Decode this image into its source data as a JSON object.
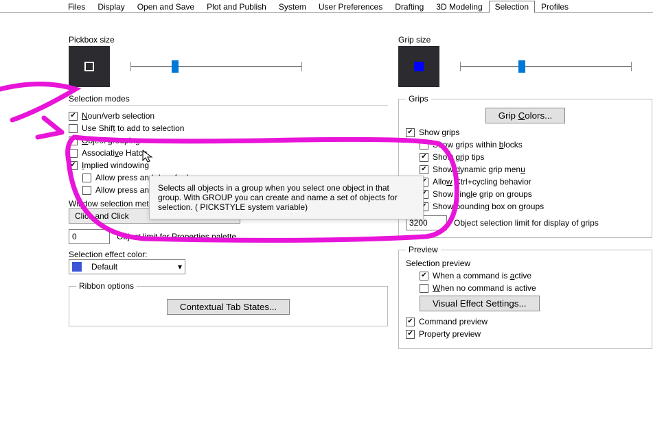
{
  "tabs": [
    "Files",
    "Display",
    "Open and Save",
    "Plot and Publish",
    "System",
    "User Preferences",
    "Drafting",
    "3D Modeling",
    "Selection",
    "Profiles"
  ],
  "active_tab": "Selection",
  "left": {
    "pickbox_label": "Pickbox size",
    "modes_label": "Selection modes",
    "modes": {
      "noun_verb": "Noun/verb selection",
      "shift_add": "Use Shift to add to selection",
      "obj_group": "Object grouping",
      "assoc_hatch": "Associative Hatch",
      "implied_window": "Implied windowing",
      "allow_press_drag": "Allow press and drag for Lasso",
      "allow_press_drag2": "Allow press and drag for Lasso",
      "win_method_label": "Window selection method:",
      "win_method_value": "Click and Click",
      "obj_limit_value": "0",
      "obj_limit_label": "Object limit for Properties palette",
      "sel_color_label": "Selection effect color:",
      "sel_color_value": "Default"
    },
    "ribbon_label": "Ribbon options",
    "ribbon_btn": "Contextual Tab States..."
  },
  "right": {
    "grip_size_label": "Grip size",
    "grips_label": "Grips",
    "grip_colors_btn": "Grip Colors...",
    "grips": {
      "show_grips": "Show grips",
      "in_blocks": "Show grips within blocks",
      "grip_tips": "Show grip tips",
      "dyn_menu": "Show dynamic grip menu",
      "ctrl_cycle": "Allow Ctrl+cycling behavior",
      "single_grip": "Show single grip on groups",
      "bbox_groups": "Show bounding box on groups",
      "limit_value": "3200",
      "limit_label": "Object selection limit for display of grips"
    },
    "preview_label": "Preview",
    "sel_preview_label": "Selection preview",
    "prev": {
      "cmd_active": "When a command is active",
      "no_cmd": "When no command is active",
      "visual_btn": "Visual Effect Settings...",
      "cmd_preview": "Command preview",
      "prop_preview": "Property preview"
    }
  },
  "tooltip_text": "Selects all objects in a group when you select one object in that group. With GROUP you can create and name a set of objects for selection. ( PICKSTYLE system variable)"
}
